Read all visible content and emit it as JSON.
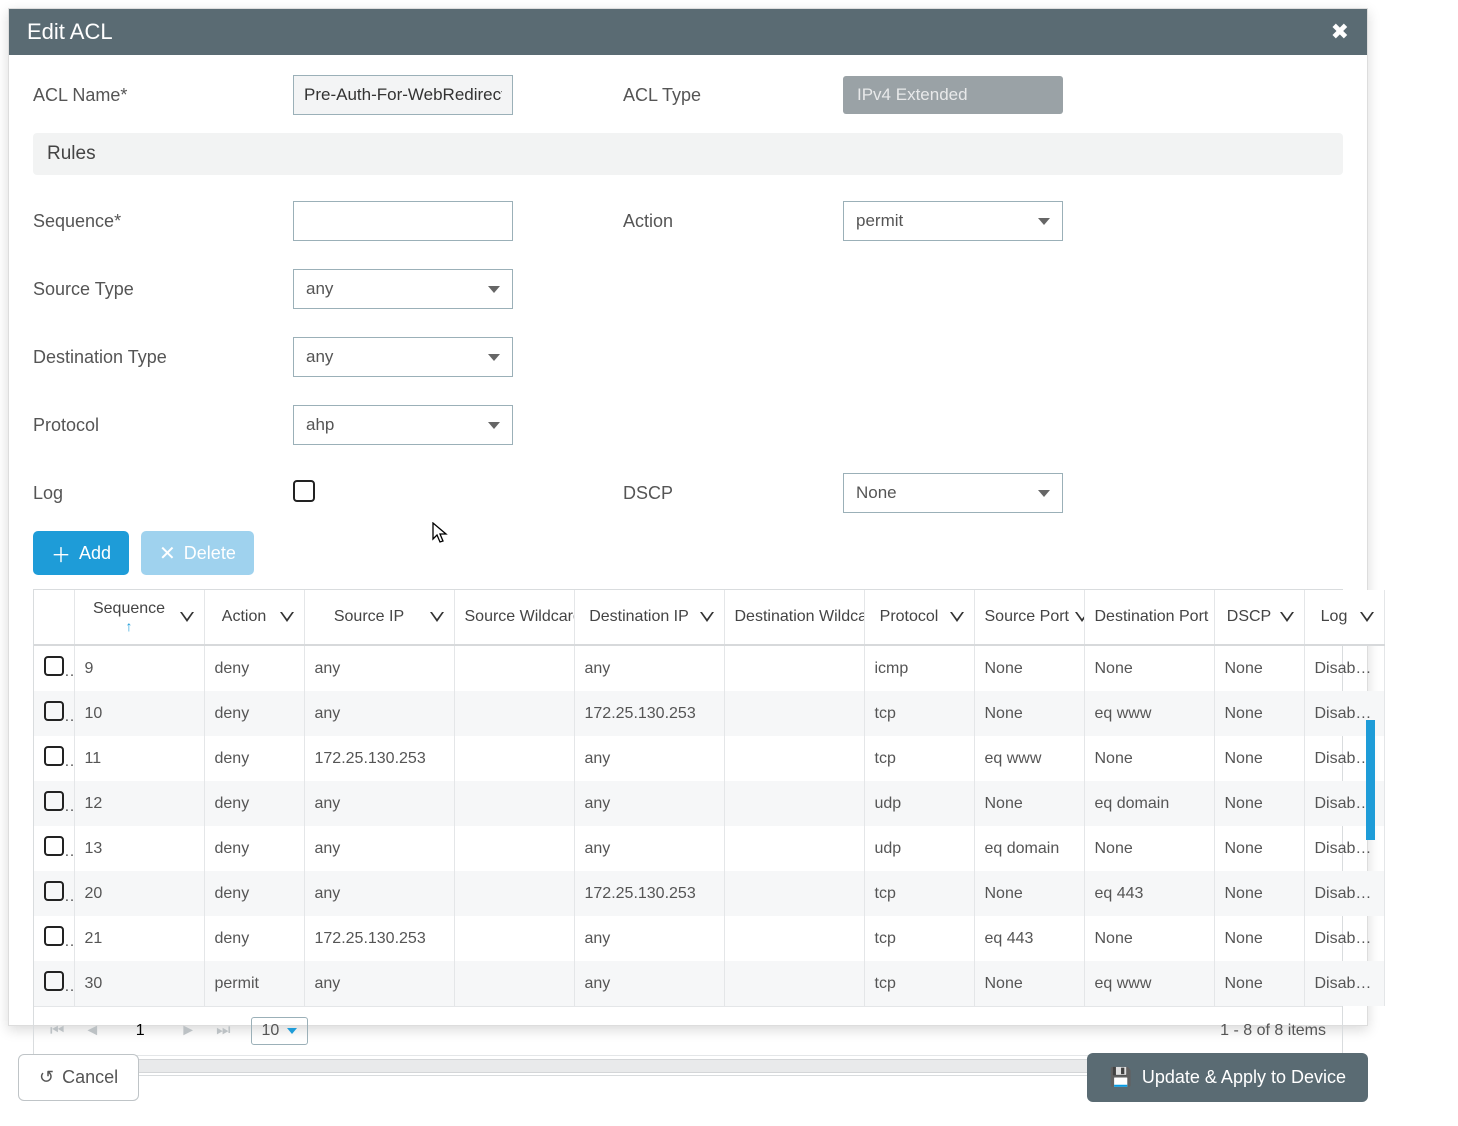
{
  "title": "Edit ACL",
  "form": {
    "acl_name_label": "ACL Name*",
    "acl_name_value": "Pre-Auth-For-WebRedirect",
    "acl_type_label": "ACL Type",
    "acl_type_value": "IPv4 Extended",
    "rules_heading": "Rules",
    "sequence_label": "Sequence*",
    "sequence_value": "",
    "action_label": "Action",
    "action_value": "permit",
    "source_type_label": "Source Type",
    "source_type_value": "any",
    "dest_type_label": "Destination Type",
    "dest_type_value": "any",
    "protocol_label": "Protocol",
    "protocol_value": "ahp",
    "log_label": "Log",
    "dscp_label": "DSCP",
    "dscp_value": "None"
  },
  "buttons": {
    "add": "Add",
    "delete": "Delete",
    "cancel": "Cancel",
    "apply": "Update & Apply to Device"
  },
  "table": {
    "headers": {
      "sequence": "Sequence",
      "action": "Action",
      "src_ip": "Source IP",
      "src_wc": "Source Wildcard",
      "dst_ip": "Destination IP",
      "dst_wc": "Destination Wildcard",
      "protocol": "Protocol",
      "src_port": "Source Port",
      "dst_port": "Destination Port",
      "dscp": "DSCP",
      "log": "Log"
    },
    "rows": [
      {
        "seq": "9",
        "action": "deny",
        "sip": "any",
        "swc": "",
        "dip": "any",
        "dwc": "",
        "proto": "icmp",
        "sport": "None",
        "dport": "None",
        "dscp": "None",
        "log": "Disabled"
      },
      {
        "seq": "10",
        "action": "deny",
        "sip": "any",
        "swc": "",
        "dip": "172.25.130.253",
        "dwc": "",
        "proto": "tcp",
        "sport": "None",
        "dport": "eq www",
        "dscp": "None",
        "log": "Disabled"
      },
      {
        "seq": "11",
        "action": "deny",
        "sip": "172.25.130.253",
        "swc": "",
        "dip": "any",
        "dwc": "",
        "proto": "tcp",
        "sport": "eq www",
        "dport": "None",
        "dscp": "None",
        "log": "Disabled"
      },
      {
        "seq": "12",
        "action": "deny",
        "sip": "any",
        "swc": "",
        "dip": "any",
        "dwc": "",
        "proto": "udp",
        "sport": "None",
        "dport": "eq domain",
        "dscp": "None",
        "log": "Disabled"
      },
      {
        "seq": "13",
        "action": "deny",
        "sip": "any",
        "swc": "",
        "dip": "any",
        "dwc": "",
        "proto": "udp",
        "sport": "eq domain",
        "dport": "None",
        "dscp": "None",
        "log": "Disabled"
      },
      {
        "seq": "20",
        "action": "deny",
        "sip": "any",
        "swc": "",
        "dip": "172.25.130.253",
        "dwc": "",
        "proto": "tcp",
        "sport": "None",
        "dport": "eq 443",
        "dscp": "None",
        "log": "Disabled"
      },
      {
        "seq": "21",
        "action": "deny",
        "sip": "172.25.130.253",
        "swc": "",
        "dip": "any",
        "dwc": "",
        "proto": "tcp",
        "sport": "eq 443",
        "dport": "None",
        "dscp": "None",
        "log": "Disabled"
      },
      {
        "seq": "30",
        "action": "permit",
        "sip": "any",
        "swc": "",
        "dip": "any",
        "dwc": "",
        "proto": "tcp",
        "sport": "None",
        "dport": "eq www",
        "dscp": "None",
        "log": "Disabled"
      }
    ]
  },
  "pager": {
    "page": "1",
    "page_size": "10",
    "summary": "1 - 8 of 8 items"
  }
}
